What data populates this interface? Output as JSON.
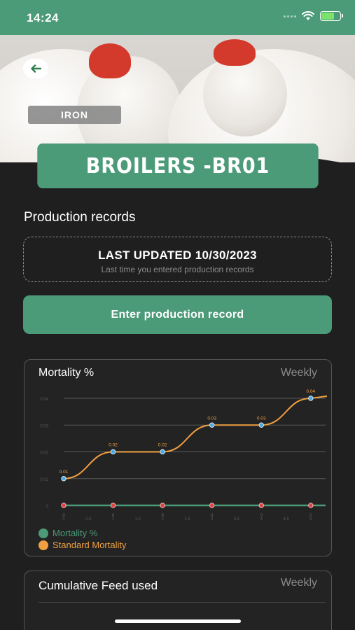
{
  "status_bar": {
    "time": "14:24"
  },
  "hero": {
    "tag": "IRON",
    "title": "BROILERS -BR01"
  },
  "production": {
    "section_title": "Production records",
    "last_updated": "LAST UPDATED 10/30/2023",
    "last_updated_hint": "Last time you entered production records",
    "enter_button": "Enter production record"
  },
  "mortality_card": {
    "title": "Mortality %",
    "period": "Weekly",
    "legend": [
      {
        "label": "Mortality %",
        "color": "#4b9a78"
      },
      {
        "label": "Standard Mortality",
        "color": "#f0a040"
      }
    ]
  },
  "feed_card": {
    "title": "Cumulative Feed used",
    "period": "Weekly"
  },
  "colors": {
    "accent": "#4b9a78",
    "standard": "#f0a040",
    "mortality_point": "#e04040",
    "standard_point": "#4aa8e0"
  },
  "chart_data": {
    "type": "line",
    "title": "Mortality %",
    "x": [
      0,
      1,
      2,
      3,
      4,
      5
    ],
    "x_ticks": [
      "0",
      "0.5",
      "1",
      "1.5",
      "2",
      "2.5",
      "3",
      "3.5",
      "4",
      "4.5",
      "5"
    ],
    "y_ticks": [
      "0",
      "0.01",
      "0.02",
      "0.03",
      "0.04"
    ],
    "ylim": [
      0,
      0.04
    ],
    "grid": true,
    "series": [
      {
        "name": "Mortality %",
        "values": [
          0,
          0,
          0,
          0,
          0,
          0
        ],
        "labels": [
          "0",
          "0",
          "0",
          "0",
          "0",
          "0"
        ]
      },
      {
        "name": "Standard Mortality",
        "values": [
          0.01,
          0.02,
          0.02,
          0.03,
          0.03,
          0.04
        ],
        "labels": [
          "0.01",
          "0.02",
          "0.02",
          "0.03",
          "0.03",
          "0.04"
        ]
      }
    ],
    "legend_position": "bottom-left"
  }
}
